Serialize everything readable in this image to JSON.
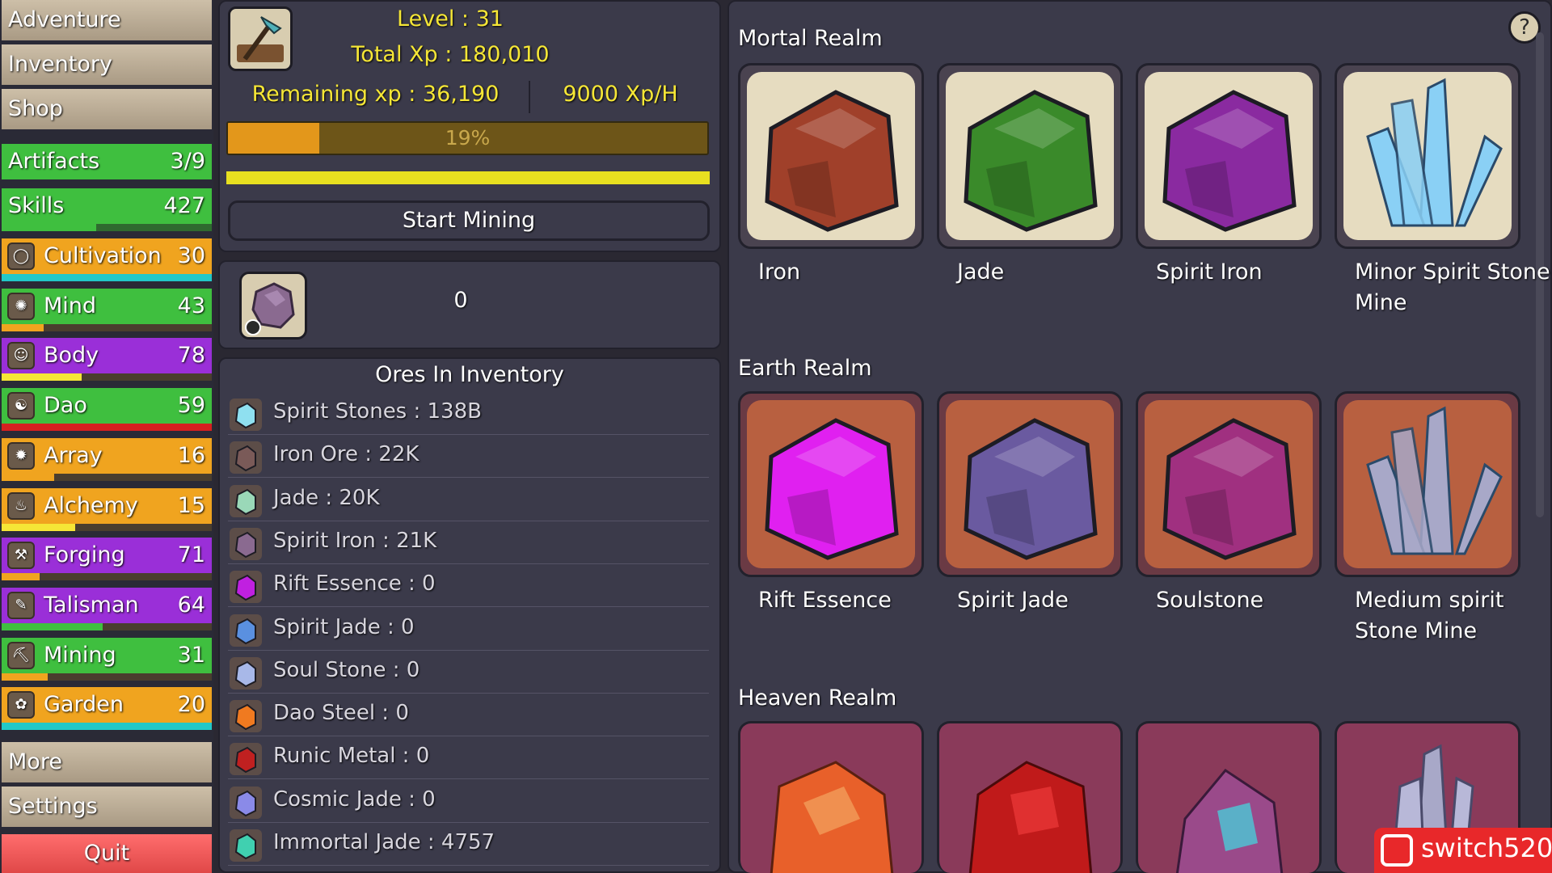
{
  "sidebar": {
    "nav": [
      "Adventure",
      "Inventory",
      "Shop"
    ],
    "artifacts": {
      "label": "Artifacts",
      "value": "3/9"
    },
    "skills_header": {
      "label": "Skills",
      "value": "427",
      "progress": 0.45
    },
    "skills": [
      {
        "label": "Cultivation",
        "value": "30",
        "color": "#f0a41f",
        "bar_color": "#22c8c8",
        "progress": 1.0,
        "icon": "orb-icon"
      },
      {
        "label": "Mind",
        "value": "43",
        "color": "#3fbf3f",
        "bar_color": "#f0a41f",
        "progress": 0.2,
        "icon": "brain-icon"
      },
      {
        "label": "Body",
        "value": "78",
        "color": "#9a2fd8",
        "bar_color": "#f5e636",
        "progress": 0.38,
        "icon": "body-icon"
      },
      {
        "label": "Dao",
        "value": "59",
        "color": "#3fbf3f",
        "bar_color": "#d62020",
        "progress": 1.0,
        "icon": "yin-yang-icon"
      },
      {
        "label": "Array",
        "value": "16",
        "color": "#f0a41f",
        "bar_color": "#f0a41f",
        "progress": 0.25,
        "icon": "array-icon"
      },
      {
        "label": "Alchemy",
        "value": "15",
        "color": "#f0a41f",
        "bar_color": "#f5e636",
        "progress": 0.35,
        "icon": "alchemy-icon"
      },
      {
        "label": "Forging",
        "value": "71",
        "color": "#9a2fd8",
        "bar_color": "#f0a41f",
        "progress": 0.18,
        "icon": "anvil-icon"
      },
      {
        "label": "Talisman",
        "value": "64",
        "color": "#9a2fd8",
        "bar_color": "#3fbf3f",
        "progress": 0.48,
        "icon": "talisman-icon"
      },
      {
        "label": "Mining",
        "value": "31",
        "color": "#3fbf3f",
        "bar_color": "#f0a41f",
        "progress": 0.22,
        "icon": "pickaxe-icon"
      },
      {
        "label": "Garden",
        "value": "20",
        "color": "#f0a41f",
        "bar_color": "#22c8c8",
        "progress": 1.0,
        "icon": "garden-icon"
      }
    ],
    "more": "More",
    "settings": "Settings",
    "quit": "Quit"
  },
  "mining": {
    "level": "Level : 31",
    "total_xp": "Total Xp : 180,010",
    "remaining_xp": "Remaining xp : 36,190",
    "xp_rate": "9000 Xp/H",
    "progress_text": "19%",
    "progress": 0.19,
    "start_button": "Start Mining",
    "selected_count": "0"
  },
  "inventory": {
    "title": "Ores In Inventory",
    "ores": [
      {
        "label": "Spirit Stones : 138B",
        "color": "#8fe0f0"
      },
      {
        "label": "Iron Ore : 22K",
        "color": "#7a5a58"
      },
      {
        "label": "Jade : 20K",
        "color": "#9ad8b8"
      },
      {
        "label": "Spirit Iron : 21K",
        "color": "#8a6a90"
      },
      {
        "label": "Rift Essence : 0",
        "color": "#c020e0"
      },
      {
        "label": "Spirit Jade : 0",
        "color": "#5a90e0"
      },
      {
        "label": "Soul Stone : 0",
        "color": "#a8b8e8"
      },
      {
        "label": "Dao Steel : 0",
        "color": "#f07a20"
      },
      {
        "label": "Runic Metal : 0",
        "color": "#c02020"
      },
      {
        "label": "Cosmic Jade : 0",
        "color": "#8a8ae8"
      },
      {
        "label": "Immortal Jade : 4757",
        "color": "#40d0b0"
      }
    ]
  },
  "realms": {
    "mortal": {
      "title": "Mortal Realm",
      "ores": [
        {
          "name": "Iron",
          "color": "#a0402a"
        },
        {
          "name": "Jade",
          "color": "#3a8a2a"
        },
        {
          "name": "Spirit Iron",
          "color": "#8a2aa0"
        },
        {
          "name": "Minor Spirit Stone Mine",
          "color": "#8ad0f5"
        }
      ]
    },
    "earth": {
      "title": "Earth Realm",
      "ores": [
        {
          "name": "Rift Essence",
          "color": "#e020f0"
        },
        {
          "name": "Spirit Jade",
          "color": "#6a5aa0"
        },
        {
          "name": "Soulstone",
          "color": "#a03080"
        },
        {
          "name": "Medium spirit Stone Mine",
          "color": "#a8a8c8"
        }
      ]
    },
    "heaven": {
      "title": "Heaven Realm"
    }
  },
  "help_icon": "?",
  "watermark": "switch520"
}
